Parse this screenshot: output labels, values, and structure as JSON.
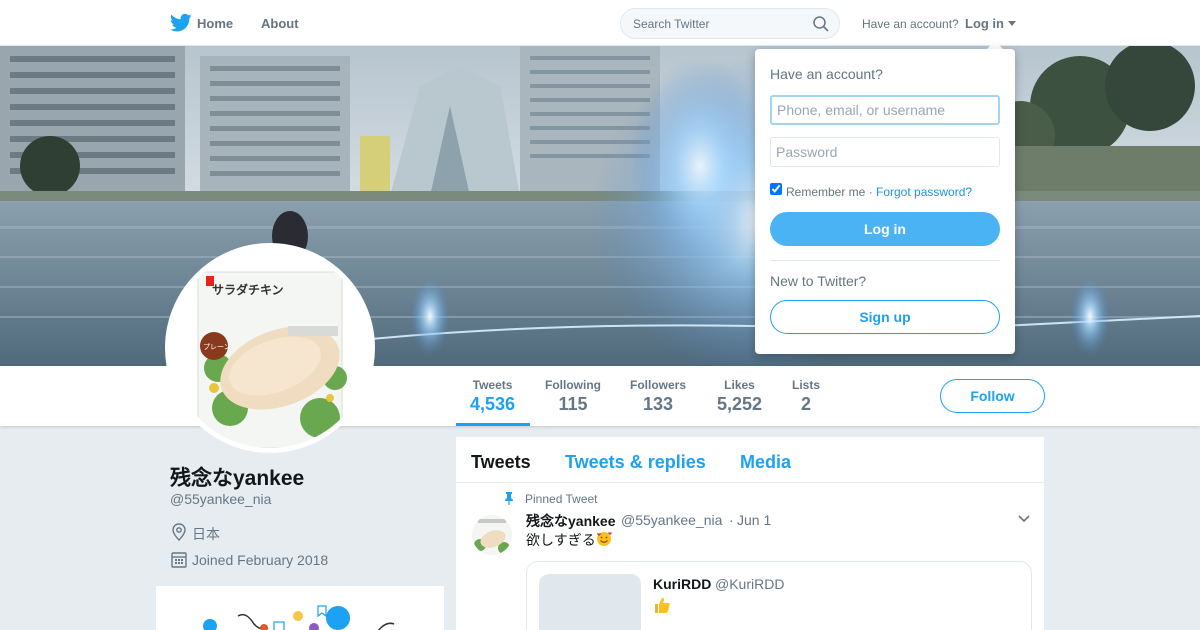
{
  "nav": {
    "home_label": "Home",
    "about_label": "About",
    "search_placeholder": "Search Twitter",
    "have_account_text": "Have an account?",
    "login_label": "Log in"
  },
  "profile": {
    "fullname": "残念なyankee",
    "handle": "@55yankee_nia",
    "location": "日本",
    "joined": "Joined February 2018",
    "follow_label": "Follow",
    "avatar_text": "サラダチキン",
    "avatar_badge": "プレーン"
  },
  "stats": [
    {
      "label": "Tweets",
      "value": "4,536"
    },
    {
      "label": "Following",
      "value": "115"
    },
    {
      "label": "Followers",
      "value": "133"
    },
    {
      "label": "Likes",
      "value": "5,252"
    },
    {
      "label": "Lists",
      "value": "2"
    }
  ],
  "timeline": {
    "tabs": [
      {
        "label": "Tweets"
      },
      {
        "label": "Tweets & replies"
      },
      {
        "label": "Media"
      }
    ],
    "pinned_label": "Pinned Tweet",
    "tweet": {
      "name": "残念なyankee",
      "handle": "@55yankee_nia",
      "dot": "·",
      "date": "Jun 1",
      "text": "欲しすぎる"
    },
    "quote": {
      "name": "KuriRDD",
      "handle": "@KuriRDD"
    }
  },
  "login_dropdown": {
    "title": "Have an account?",
    "username_placeholder": "Phone, email, or username",
    "password_placeholder": "Password",
    "remember_label": "Remember me ·",
    "forgot_label": "Forgot password?",
    "login_button": "Log in",
    "new_text": "New to Twitter?",
    "signup_button": "Sign up"
  },
  "colors": {
    "brand_blue": "#1da1f2",
    "background": "#e6ecf0",
    "muted_text": "#657786"
  },
  "icons": [
    "twitter-bird-icon",
    "search-icon",
    "caret-down-icon",
    "location-pin-icon",
    "calendar-icon",
    "pin-icon",
    "chevron-down-icon",
    "smiling-hearts-emoji",
    "thumbs-up-emoji"
  ]
}
